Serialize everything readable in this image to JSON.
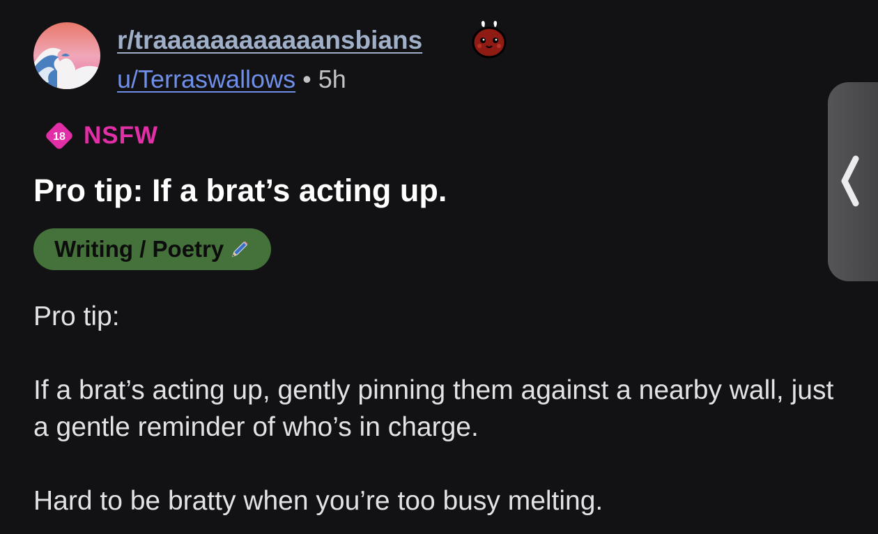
{
  "post": {
    "subreddit": "r/traaaaaaaaaaaansbians",
    "author": "u/Terraswallows",
    "separator": "•",
    "age": "5h",
    "nsfw_badge_number": "18",
    "nsfw_label": "NSFW",
    "title": "Pro tip: If a brat’s acting up.",
    "flair": "Writing / Poetry",
    "flair_icon": "pencil-icon",
    "body": [
      "Pro tip:",
      "If a brat’s acting up, gently pinning them against a nearby wall, just a gentle reminder of who’s in charge.",
      "Hard to be bratty when you’re too busy melting."
    ]
  },
  "icons": {
    "avatar": "wave-painting-avatar",
    "award": "red-critter-award-icon",
    "edge_handle": "chevron-left-icon"
  },
  "colors": {
    "background": "#121214",
    "subreddit_link": "#9fb0c8",
    "author_link": "#6f8fe8",
    "nsfw": "#e22fa7",
    "flair_background": "#45723a"
  }
}
